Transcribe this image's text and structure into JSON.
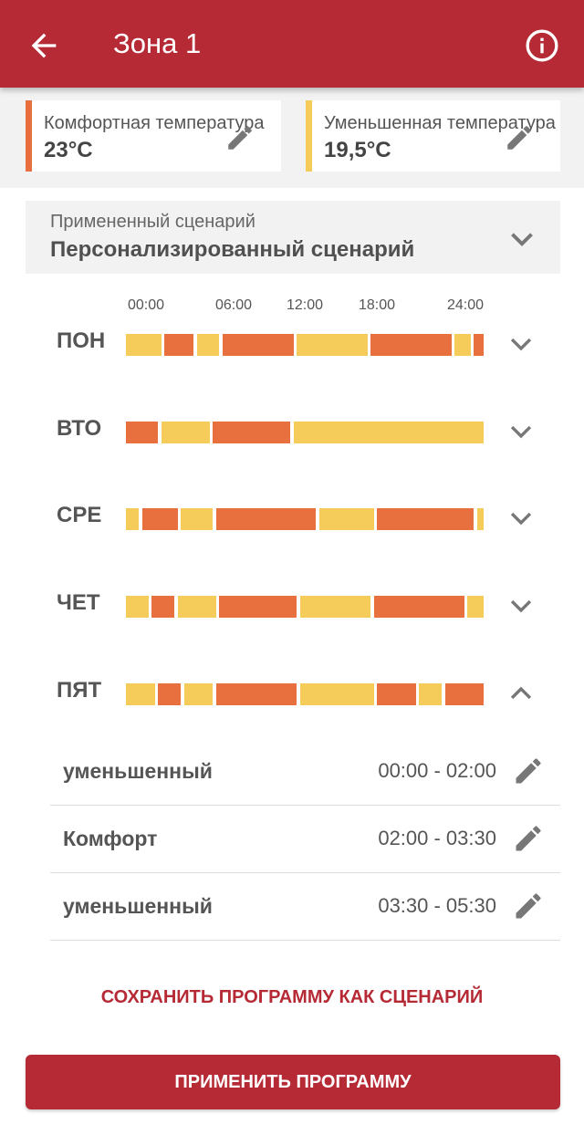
{
  "header": {
    "title": "Зона 1",
    "back_icon": "arrow-left-icon",
    "info_icon": "info-icon"
  },
  "temperatures": {
    "comfort": {
      "label": "Комфортная температура",
      "value": "23°C",
      "color": "#e8703f"
    },
    "reduced": {
      "label": "Уменьшенная температура",
      "value": "19,5°C",
      "color": "#f5cc5a"
    }
  },
  "scenario": {
    "label": "Примененный сценарий",
    "value": "Персонализированный сценарий"
  },
  "timeline": {
    "labels": [
      "00:00",
      "06:00",
      "12:00",
      "18:00",
      "24:00"
    ]
  },
  "colors": {
    "accent": "#b52a35",
    "comfort": "#e8703f",
    "reduced": "#f5cc5a"
  },
  "days": [
    {
      "name": "ПОН",
      "expanded": false,
      "segments": [
        {
          "mode": "r",
          "from": "00:00",
          "to": "02:45"
        },
        {
          "mode": "c",
          "from": "03:00",
          "to": "05:15"
        },
        {
          "mode": "r",
          "from": "05:30",
          "to": "07:15"
        },
        {
          "mode": "c",
          "from": "07:30",
          "to": "13:00"
        },
        {
          "mode": "r",
          "from": "13:15",
          "to": "18:45"
        },
        {
          "mode": "c",
          "from": "19:00",
          "to": "25:15"
        },
        {
          "mode": "r",
          "from": "25:30",
          "to": "26:45"
        },
        {
          "mode": "c",
          "from": "27:00",
          "to": "27:45"
        }
      ]
    },
    {
      "name": "ВТО",
      "expanded": false,
      "segments": [
        {
          "mode": "c",
          "from": "00:00",
          "to": "02:30"
        },
        {
          "mode": "r",
          "from": "02:45",
          "to": "06:30"
        },
        {
          "mode": "c",
          "from": "06:45",
          "to": "12:45"
        },
        {
          "mode": "r",
          "from": "13:00",
          "to": "27:45"
        }
      ]
    },
    {
      "name": "СРЕ",
      "expanded": false,
      "segments": [
        {
          "mode": "r",
          "from": "00:00",
          "to": "01:00"
        },
        {
          "mode": "c",
          "from": "01:15",
          "to": "04:00"
        },
        {
          "mode": "r",
          "from": "04:15",
          "to": "06:45"
        },
        {
          "mode": "c",
          "from": "07:00",
          "to": "14:45"
        },
        {
          "mode": "r",
          "from": "15:00",
          "to": "19:15"
        },
        {
          "mode": "c",
          "from": "19:30",
          "to": "27:00"
        },
        {
          "mode": "r",
          "from": "27:15",
          "to": "27:45"
        }
      ]
    },
    {
      "name": "ЧЕТ",
      "expanded": false,
      "segments": [
        {
          "mode": "r",
          "from": "00:00",
          "to": "01:45"
        },
        {
          "mode": "c",
          "from": "02:00",
          "to": "03:45"
        },
        {
          "mode": "r",
          "from": "04:00",
          "to": "07:00"
        },
        {
          "mode": "c",
          "from": "07:15",
          "to": "13:15"
        },
        {
          "mode": "r",
          "from": "13:30",
          "to": "19:00"
        },
        {
          "mode": "c",
          "from": "19:15",
          "to": "26:15"
        },
        {
          "mode": "r",
          "from": "26:30",
          "to": "27:45"
        }
      ]
    },
    {
      "name": "ПЯТ",
      "expanded": true,
      "segments": [
        {
          "mode": "r",
          "from": "00:00",
          "to": "02:15"
        },
        {
          "mode": "c",
          "from": "02:30",
          "to": "04:15"
        },
        {
          "mode": "r",
          "from": "04:30",
          "to": "06:45"
        },
        {
          "mode": "c",
          "from": "07:00",
          "to": "13:15"
        },
        {
          "mode": "r",
          "from": "13:30",
          "to": "19:15"
        },
        {
          "mode": "c",
          "from": "19:30",
          "to": "22:30"
        },
        {
          "mode": "r",
          "from": "22:45",
          "to": "24:30"
        },
        {
          "mode": "c",
          "from": "24:45",
          "to": "27:45"
        }
      ]
    }
  ],
  "friday_periods": [
    {
      "mode": "уменьшенный",
      "range": "00:00 - 02:00"
    },
    {
      "mode": "Комфорт",
      "range": "02:00 - 03:30"
    },
    {
      "mode": "уменьшенный",
      "range": "03:30 - 05:30"
    }
  ],
  "actions": {
    "save_label": "СОХРАНИТЬ ПРОГРАММУ КАК СЦЕНАРИЙ",
    "apply_label": "ПРИМЕНИТЬ ПРОГРАММУ"
  }
}
